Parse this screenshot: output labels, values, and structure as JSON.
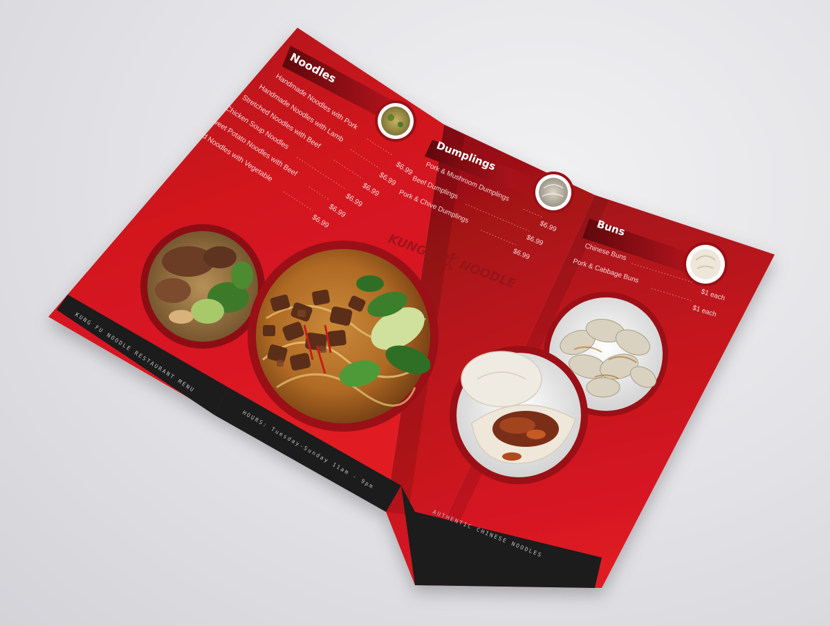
{
  "noodles": {
    "title": "Noodles",
    "items": [
      {
        "name": "Handmade Noodles with Pork",
        "price": "$6.99"
      },
      {
        "name": "Handmade Noodles with Lamb",
        "price": "$6.99"
      },
      {
        "name": "Stretched Noodles with Beef",
        "price": "$6.99"
      },
      {
        "name": "Chicken Soup Noodles",
        "price": "$6.99"
      },
      {
        "name": "Sweet Potato Noodles with Beef",
        "price": "$6.99"
      },
      {
        "name": "Fried Noodles with Vegetable",
        "price": "$6.99"
      }
    ]
  },
  "dumplings": {
    "title": "Dumplings",
    "items": [
      {
        "name": "Pork & Mushroom Dumplings",
        "price": "$6.99"
      },
      {
        "name": "Beef Dumplings",
        "price": "$6.99"
      },
      {
        "name": "Pork & Chive Dumplings",
        "price": "$6.99"
      }
    ]
  },
  "buns": {
    "title": "Buns",
    "items": [
      {
        "name": "Chinese Buns",
        "price": "$1 each"
      },
      {
        "name": "Pork & Cabbage Buns",
        "price": "$1 each"
      }
    ]
  },
  "logo": {
    "left": "KUNG FU",
    "right": "NOODLE"
  },
  "bands": {
    "left": "KUNG FU NOODLE RESTAURANT MENU",
    "middle": "HOURS: Tuesday-Sunday 11am - 9pm",
    "right": "AUTHENTIC CHINESE NOODLES"
  },
  "colors": {
    "paper_red": "#c8151c",
    "paper_dark": "#8e0f15",
    "band": "#1c1c1c",
    "background": "#e4e4e8"
  }
}
